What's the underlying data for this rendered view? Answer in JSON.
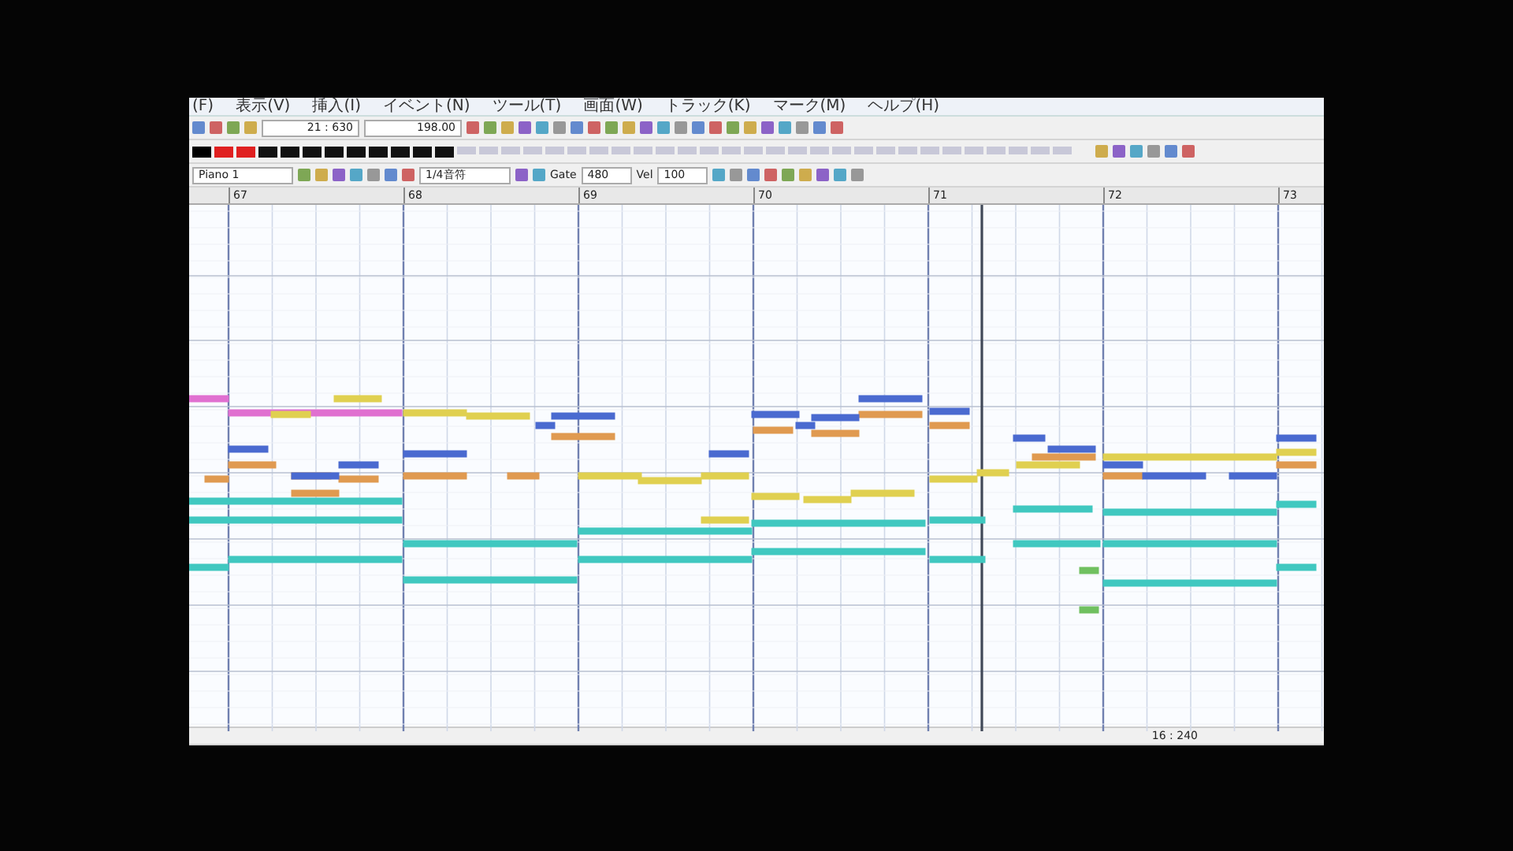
{
  "menu": [
    "(F)",
    "表示(V)",
    "挿入(I)",
    "イベント(N)",
    "ツール(T)",
    "画面(W)",
    "トラック(K)",
    "マーク(M)",
    "ヘルプ(H)"
  ],
  "toolbar": {
    "position": "21 : 630",
    "tempo": "198.00"
  },
  "event_bar": {
    "instrument": "Piano 1",
    "step": "1/4音符",
    "gate_label": "Gate",
    "gate": "480",
    "velocity_label": "Vel",
    "velocity": "100"
  },
  "ruler": [
    "67",
    "68",
    "69",
    "70",
    "71",
    "72",
    "73"
  ],
  "status_bar": {
    "position": "16 : 240"
  }
}
